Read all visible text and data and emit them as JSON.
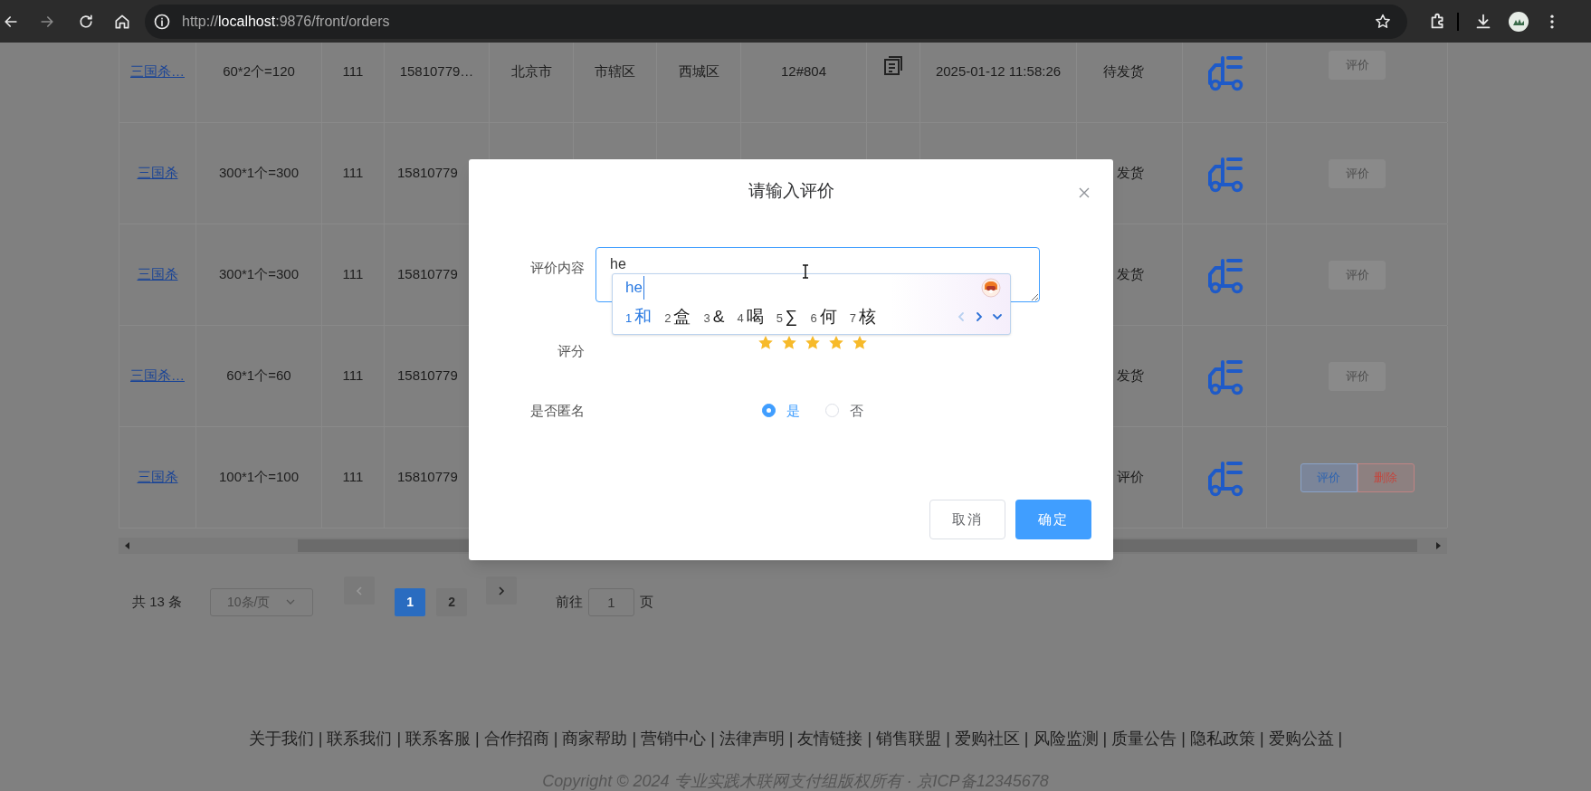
{
  "browser": {
    "url": {
      "scheme": "http://",
      "host": "localhost",
      "path": ":9876/front/orders"
    }
  },
  "table": {
    "rows": [
      {
        "product": "三国杀…",
        "price": "60*2个=120",
        "quantity": "111",
        "phone": "15810779…",
        "city": "北京市",
        "district": "市辖区",
        "county": "西城区",
        "address": "12#804",
        "has_note": true,
        "time": "2025-01-12 11:58:26",
        "status": "待发货",
        "actions": [
          {
            "label": "评价",
            "kind": "disabled"
          }
        ]
      },
      {
        "product": "三国杀",
        "price": "300*1个=300",
        "quantity": "111",
        "phone": "15810779",
        "status": "发货",
        "actions": [
          {
            "label": "评价",
            "kind": "disabled"
          }
        ]
      },
      {
        "product": "三国杀",
        "price": "300*1个=300",
        "quantity": "111",
        "phone": "15810779",
        "status": "发货",
        "actions": [
          {
            "label": "评价",
            "kind": "disabled"
          }
        ]
      },
      {
        "product": "三国杀…",
        "price": "60*1个=60",
        "quantity": "111",
        "phone": "15810779",
        "status": "发货",
        "actions": [
          {
            "label": "评价",
            "kind": "disabled"
          }
        ]
      },
      {
        "product": "三国杀",
        "price": "100*1个=100",
        "quantity": "111",
        "phone": "15810779",
        "status": "评价",
        "actions": [
          {
            "label": "评价",
            "kind": "primary"
          },
          {
            "label": "删除",
            "kind": "danger"
          }
        ]
      }
    ]
  },
  "pagination": {
    "total": "共 13 条",
    "page_size": "10条/页",
    "prev": {
      "disabled": true
    },
    "pages": [
      {
        "label": "1",
        "selected": true
      },
      {
        "label": "2",
        "selected": false
      }
    ],
    "next": {
      "disabled": false
    },
    "goto_label": "前往",
    "goto_value": "1",
    "goto_suffix": "页"
  },
  "dialog": {
    "title": "请输入评价",
    "fields": [
      {
        "kind": "textarea",
        "label": "评价内容",
        "value": "he"
      },
      {
        "kind": "rating",
        "label": "评分",
        "stars": 5
      },
      {
        "kind": "radio",
        "label": "是否匿名",
        "options": [
          {
            "label": "是",
            "selected": true
          },
          {
            "label": "否",
            "selected": false
          }
        ]
      }
    ],
    "buttons": [
      {
        "label": "取消",
        "kind": "default"
      },
      {
        "label": "确定",
        "kind": "primary"
      }
    ]
  },
  "ime": {
    "composition": "he",
    "candidates": [
      {
        "index": "1",
        "text": "和",
        "selected": true
      },
      {
        "index": "2",
        "text": "盒",
        "selected": false
      },
      {
        "index": "3",
        "text": "&",
        "selected": false
      },
      {
        "index": "4",
        "text": "喝",
        "selected": false
      },
      {
        "index": "5",
        "text": "∑",
        "selected": false
      },
      {
        "index": "6",
        "text": "何",
        "selected": false
      },
      {
        "index": "7",
        "text": "核",
        "selected": false
      }
    ],
    "prev": {
      "disabled": true
    },
    "next": {
      "disabled": false
    }
  },
  "footer": {
    "links": "关于我们 | 联系我们 | 联系客服 | 合作招商 | 商家帮助 | 营销中心 | 法律声明 | 友情链接 | 销售联盟 | 爱购社区 | 风险监测 | 质量公告 | 隐私政策 | 爱购公益 |",
    "copyright": "Copyright © 2024 专业实践木联网支付组版权所有 · 京ICP备12345678"
  }
}
